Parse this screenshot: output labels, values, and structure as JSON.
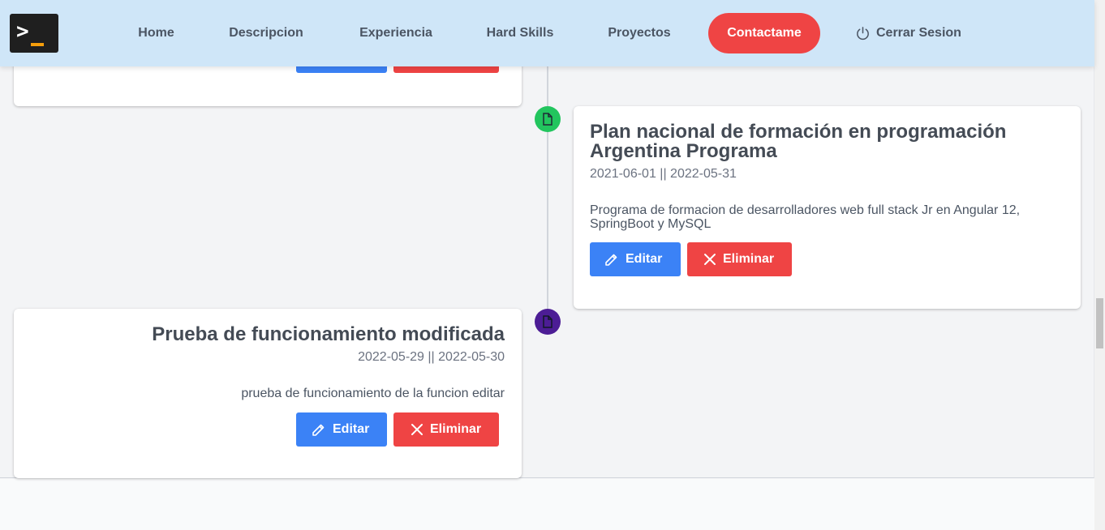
{
  "nav": {
    "items": [
      "Home",
      "Descripcion",
      "Experiencia",
      "Hard Skills",
      "Proyectos"
    ],
    "contact": "Contactame",
    "logout": "Cerrar Sesion"
  },
  "icons": {
    "logo": "terminal-prompt-icon",
    "logout": "power-icon",
    "timeline_marker": "file-icon",
    "edit": "pencil-icon",
    "delete": "close-icon"
  },
  "colors": {
    "navbar_bg": "#cfe6f8",
    "contact_btn": "#ef4444",
    "edit_btn": "#3b82f6",
    "delete_btn": "#ef4444",
    "dot_green": "#22c55e",
    "dot_purple": "#4c1d95"
  },
  "education": [
    {
      "title_line1": "Plan nacional de formación en programación",
      "title_line2": "Argentina Programa",
      "dates": "2021-06-01 || 2022-05-31",
      "description_line1": "Programa de formacion de desarrolladores web full stack Jr en Angular 12,",
      "description_line2": "SpringBoot y MySQL",
      "edit_label": "Editar",
      "delete_label": "Eliminar"
    },
    {
      "title": "Prueba de funcionamiento modificada",
      "dates": "2022-05-29 || 2022-05-30",
      "description": "prueba de funcionamiento de la funcion editar",
      "edit_label": "Editar",
      "delete_label": "Eliminar"
    }
  ]
}
